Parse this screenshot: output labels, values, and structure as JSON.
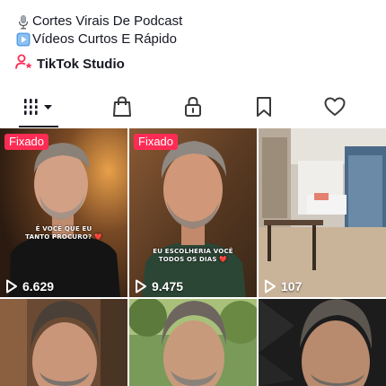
{
  "profile": {
    "bio_lines": [
      {
        "icon": "microphone-icon",
        "text": "Cortes Virais De Podcast"
      },
      {
        "icon": "video-play-icon",
        "text": "Vídeos Curtos E Rápido"
      }
    ],
    "studio": {
      "icon": "person-star-icon",
      "label": "TikTok Studio"
    }
  },
  "tabs": [
    {
      "icon": "grid-icon",
      "name": "videos",
      "active": true
    },
    {
      "icon": "shopping-bag-icon",
      "name": "shop"
    },
    {
      "icon": "lock-icon",
      "name": "private"
    },
    {
      "icon": "bookmark-icon",
      "name": "favorites"
    },
    {
      "icon": "heart-icon",
      "name": "liked"
    }
  ],
  "videos": [
    {
      "pinned": "Fixado",
      "caption": "É VOCÊ QUE EU\nTANTO PROCURO? ❤️",
      "views": "6.629"
    },
    {
      "pinned": "Fixado",
      "caption": "EU ESCOLHERIA VOCÊ\nTODOS OS DIAS ❤️",
      "views": "9.475"
    },
    {
      "views": "107"
    },
    {},
    {},
    {}
  ],
  "colors": {
    "accent": "#fe2c55",
    "text": "#161823",
    "divider": "#d9d9d9"
  }
}
